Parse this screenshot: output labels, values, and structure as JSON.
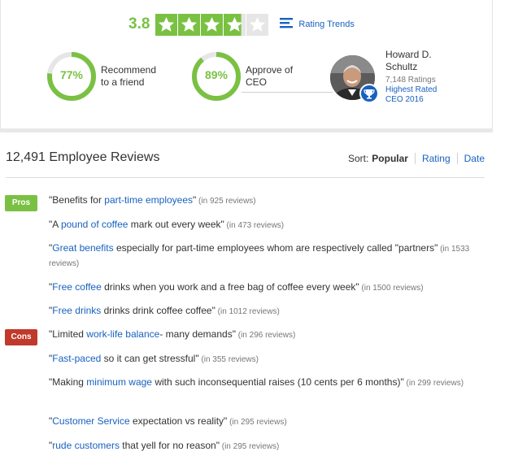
{
  "colors": {
    "green": "#7ac143",
    "blue": "#1861bf",
    "red": "#c0392b",
    "empty_star": "#e6e6e6"
  },
  "rating": {
    "value": "3.8",
    "stars_filled": 3.8,
    "trends_label": "Rating Trends"
  },
  "recommend": {
    "percent_text": "77%",
    "percent": 77,
    "label_line1": "Recommend",
    "label_line2": "to a friend"
  },
  "approve": {
    "percent_text": "89%",
    "percent": 89,
    "label_line1": "Approve of",
    "label_line2": "CEO"
  },
  "ceo": {
    "name_line1": "Howard D.",
    "name_line2": "Schultz",
    "ratings_count": "7,148 Ratings",
    "award_line1": "Highest Rated",
    "award_line2": "CEO 2016",
    "badge_icon": "trophy-icon"
  },
  "reviews": {
    "count_title": "12,491 Employee Reviews",
    "sort_label": "Sort:",
    "sort_active": "Popular",
    "sort_options": [
      "Rating",
      "Date"
    ]
  },
  "pros_tag": "Pros",
  "cons_tag": "Cons",
  "pros": [
    {
      "before": "\"Benefits for ",
      "link": "part-time employees",
      "after": "\"",
      "count": " (in 925 reviews)"
    },
    {
      "before": "\"A ",
      "link": "pound of coffee",
      "after": " mark out every week\"",
      "count": " (in 473 reviews)"
    },
    {
      "before": "\"",
      "link": "Great benefits",
      "after": " especially for part-time employees whom are respectively called \"partners\"",
      "count": " (in 1533 reviews)"
    },
    {
      "before": "\"",
      "link": "Free coffee",
      "after": " drinks when you work and a free bag of coffee every week\"",
      "count": " (in 1500 reviews)"
    },
    {
      "before": "\"",
      "link": "Free drinks",
      "after": " drinks drink coffee coffee\"",
      "count": " (in 1012 reviews)"
    }
  ],
  "cons": [
    {
      "before": "\"Limited ",
      "link": "work-life balance",
      "after": "- many demands\"",
      "count": " (in 296 reviews)"
    },
    {
      "before": "\"",
      "link": "Fast-paced",
      "after": " so it can get stressful\"",
      "count": " (in 355 reviews)"
    },
    {
      "before": "\"Making ",
      "link": "minimum wage",
      "after": " with such inconsequential raises (10 cents per 6 months)\"",
      "count": " (in 299 reviews)"
    },
    {
      "before": "\"",
      "link": "Customer Service",
      "after": " expectation vs reality\"",
      "count": " (in 295 reviews)"
    },
    {
      "before": "\"",
      "link": "rude customers",
      "after": " that yell for no reason\"",
      "count": " (in 295 reviews)"
    }
  ]
}
